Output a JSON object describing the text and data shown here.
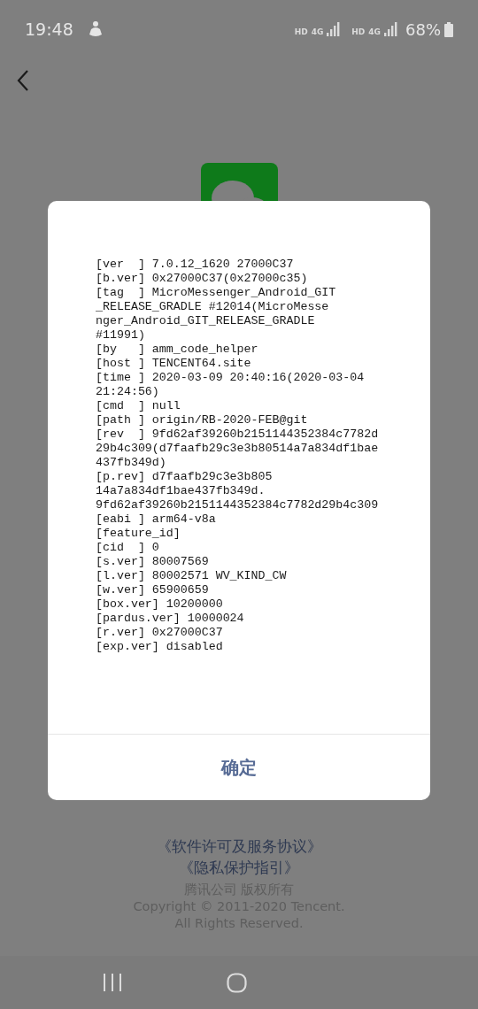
{
  "status_bar": {
    "time": "19:48",
    "sim1": {
      "hd": "HD",
      "network": "4G"
    },
    "sim2": {
      "hd": "HD",
      "network": "4G"
    },
    "battery": "68%"
  },
  "dialog": {
    "log_lines": [
      "[ver  ] 7.0.12_1620 27000C37",
      "[b.ver] 0x27000C37(0x27000c35)",
      "[tag  ] MicroMessenger_Android_GIT",
      "_RELEASE_GRADLE #12014(MicroMesse",
      "nger_Android_GIT_RELEASE_GRADLE",
      "#11991)",
      "[by   ] amm_code_helper",
      "[host ] TENCENT64.site",
      "[time ] 2020-03-09 20:40:16(2020-03-04",
      "21:24:56)",
      "[cmd  ] null",
      "[path ] origin/RB-2020-FEB@git",
      "[rev  ] 9fd62af39260b2151144352384c7782d",
      "29b4c309(d7faafb29c3e3b80514a7a834df1bae",
      "437fb349d)",
      "[p.rev] d7faafb29c3e3b805",
      "14a7a834df1bae437fb349d.",
      "9fd62af39260b2151144352384c7782d29b4c309",
      "[eabi ] arm64-v8a",
      "[feature_id]",
      "[cid  ] 0",
      "[s.ver] 80007569",
      "[l.ver] 80002571 WV_KIND_CW",
      "[w.ver] 65900659",
      "[box.ver] 10200000",
      "[pardus.ver] 10000024",
      "[r.ver] 0x27000C37",
      "[exp.ver] disabled"
    ],
    "button": "确定"
  },
  "footer": {
    "links": [
      "《软件许可及服务协议》",
      "《隐私保护指引》"
    ],
    "company": "腾讯公司 版权所有",
    "copyright": "Copyright © 2011-2020 Tencent.",
    "rights": "All Rights Reserved."
  }
}
